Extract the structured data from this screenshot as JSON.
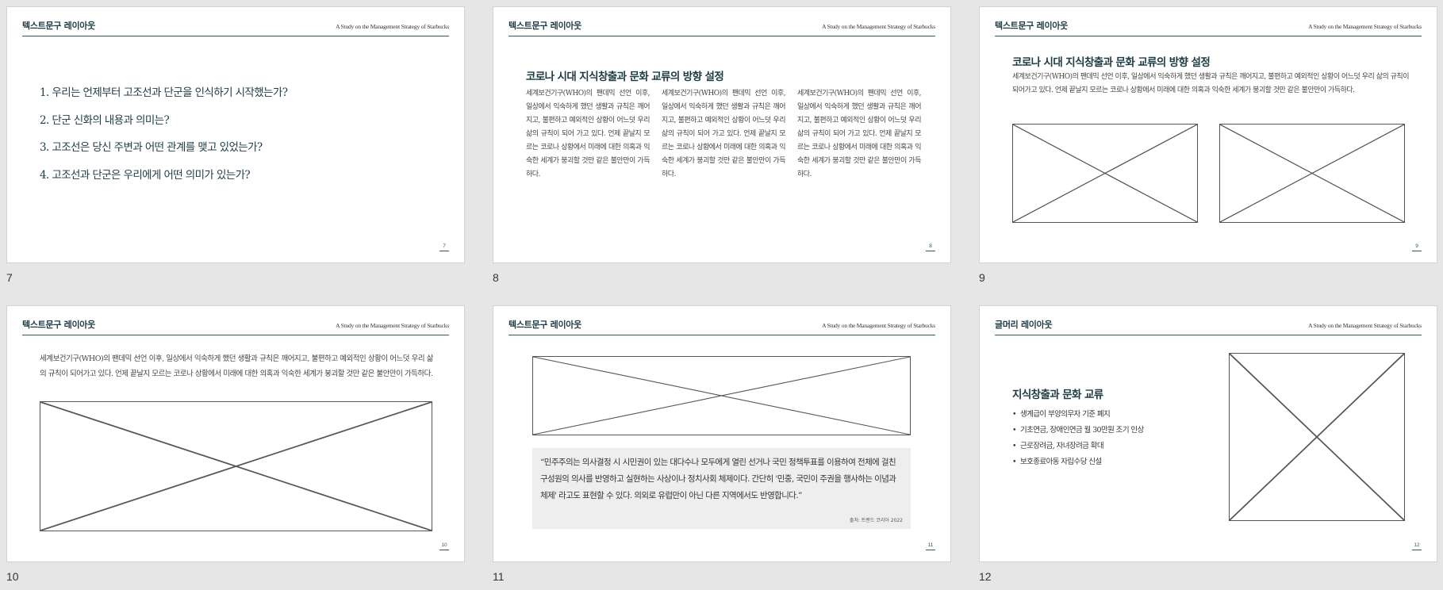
{
  "header_subtitle": "A Study on the Management Strategy of Starbucks",
  "slides": [
    {
      "number_label": "7",
      "header_title": "텍스트문구 레이아웃",
      "page_num": "7",
      "questions": [
        "1.  우리는 언제부터 고조선과 단군을 인식하기 시작했는가?",
        "2.  단군 신화의 내용과 의미는?",
        "3.  고조선은 당신 주변과 어떤 관계를 맺고 있었는가?",
        "4.  고조선과 단군은 우리에게 어떤 의미가 있는가?"
      ]
    },
    {
      "number_label": "8",
      "header_title": "텍스트문구 레이아웃",
      "page_num": "8",
      "heading": "코로나 시대 지식창출과 문화 교류의 방향 설정",
      "columns": [
        "세계보건기구(WHO)의 팬데믹 선언 이후, 일상에서 익숙하게 했던 생활과 규칙은 깨어지고, 불편하고 예외적인 상황이 어느덧 우리 삶의 규칙이 되어 가고 있다. 언제 끝날지 모르는 코로나 상황에서 미래에 대한 의혹과 익숙한 세계가 붕괴할 것만 같은 불안만이 가득하다.",
        "세계보건기구(WHO)의 팬데믹 선언 이후, 일상에서 익숙하게 했던 생활과 규칙은 깨어지고, 불편하고 예외적인 상황이 어느덧 우리 삶의 규칙이 되어 가고 있다. 언제 끝날지 모르는 코로나 상황에서 미래에 대한 의혹과 익숙한 세계가 붕괴할 것만 같은 불안만이 가득하다.",
        "세계보건기구(WHO)의 팬데믹 선언 이후, 일상에서 익숙하게 했던 생활과 규칙은 깨어지고, 불편하고 예외적인 상황이 어느덧 우리 삶의 규칙이 되어 가고 있다. 언제 끝날지 모르는 코로나 상황에서 미래에 대한 의혹과 익숙한 세계가 붕괴할 것만 같은 불안만이 가득하다."
      ]
    },
    {
      "number_label": "9",
      "header_title": "텍스트문구 레이아웃",
      "page_num": "9",
      "heading": "코로나 시대 지식창출과 문화 교류의 방향 설정",
      "body": "세계보건기구(WHO)의 팬데믹 선언 이후, 일상에서 익숙하게 했던 생활과 규칙은 깨어지고, 불편하고 예외적인 상황이 어느덧 우리 삶의 규칙이 되어가고 있다. 언제 끝날지 모르는 코로나 상황에서 미래에 대한 의혹과 익숙한 세계가 붕괴할 것만 같은 불안만이 가득하다."
    },
    {
      "number_label": "10",
      "header_title": "텍스트문구 레이아웃",
      "page_num": "10",
      "body": "세계보건기구(WHO)의 팬데믹 선언 이후, 일상에서 익숙하게 했던 생활과 규칙은 깨어지고, 불편하고 예외적인 상황이 어느덧 우리 삶의 규칙이 되어가고 있다. 언제 끝날지 모르는 코로나 상황에서 미래에 대한 의혹과 익숙한 세계가 붕괴할 것만 같은 불안만이 가득하다."
    },
    {
      "number_label": "11",
      "header_title": "텍스트문구 레이아웃",
      "page_num": "11",
      "quote": "“민주주의는 의사결정 시 시민권이 있는 대다수나 모두에게 열린 선거나 국민 정책투표를 이용하여 전체에 걸친 구성원의 의사를 반영하고 실현하는 사상이나 정치사회 체제이다. 간단히 '민중, 국민이 주권을 행사하는 이념과 체제' 라고도 표현할 수 있다. 의외로 유럽만이 아닌 다른 지역에서도 반영합니다.”",
      "source": "출처: 트렌드 코리아 2022"
    },
    {
      "number_label": "12",
      "header_title": "글머리 레이아웃",
      "page_num": "12",
      "heading": "지식창출과 문화 교류",
      "bullets": [
        "생계급이 부양의무자 기준 폐지",
        "기초연금, 장애인연금 월 30만원 조기 인상",
        "근로장려금, 자녀장려금 확대",
        "보호종료아동 자립수당 신설"
      ]
    }
  ]
}
